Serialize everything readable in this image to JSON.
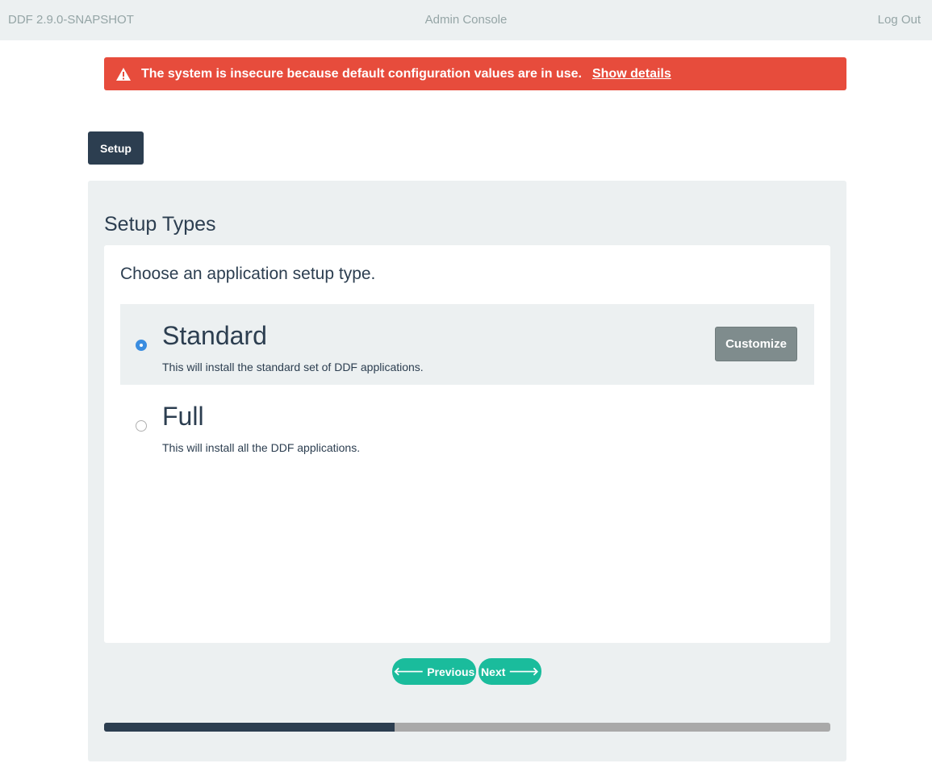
{
  "navbar": {
    "brand": "DDF 2.9.0-SNAPSHOT",
    "title": "Admin Console",
    "logout": "Log Out"
  },
  "alert": {
    "icon": "warning-triangle-icon",
    "message": "The system is insecure because default configuration values are in use.",
    "link": "Show details",
    "color": "#e74c3c"
  },
  "tab": {
    "label": "Setup"
  },
  "panel": {
    "title": "Setup Types",
    "prompt": "Choose an application setup type.",
    "options": [
      {
        "name": "Standard",
        "description": "This will install the standard set of DDF applications.",
        "selected": true,
        "customize_label": "Customize"
      },
      {
        "name": "Full",
        "description": "This will install all the DDF applications.",
        "selected": false
      }
    ]
  },
  "wizard": {
    "previous_label": "Previous",
    "next_label": "Next",
    "previous_icon": "arrow-left-icon",
    "next_icon": "arrow-right-icon",
    "progress_fraction": 0.4,
    "accent": "#1abc9c",
    "progress_color": "#2c3e50"
  }
}
